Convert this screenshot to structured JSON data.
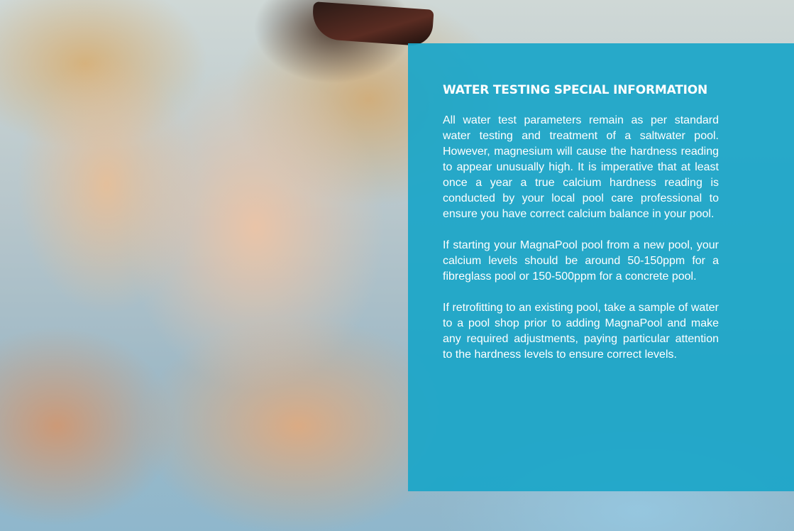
{
  "heading": "WATER TESTING SPECIAL INFORMATION",
  "paragraphs": [
    "All water test parameters remain as per standard water testing and treatment of a saltwater pool. However, magnesium will cause the hardness reading to appear unusually high. It is imperative that at least once a year a true calcium hardness reading is conducted by your local pool care professional to ensure you have correct calcium balance in your pool.",
    "If starting your MagnaPool pool from a new pool, your calcium levels should be around 50-150ppm for a fibreglass pool or 150-500ppm for a concrete pool.",
    "If retrofitting to an existing pool, take a sample of water to a pool shop prior to adding MagnaPool and make any required adjustments, paying particular attention to the hardness levels to ensure correct levels."
  ],
  "colors": {
    "panel": "#1ba6c8",
    "text": "#ffffff"
  }
}
